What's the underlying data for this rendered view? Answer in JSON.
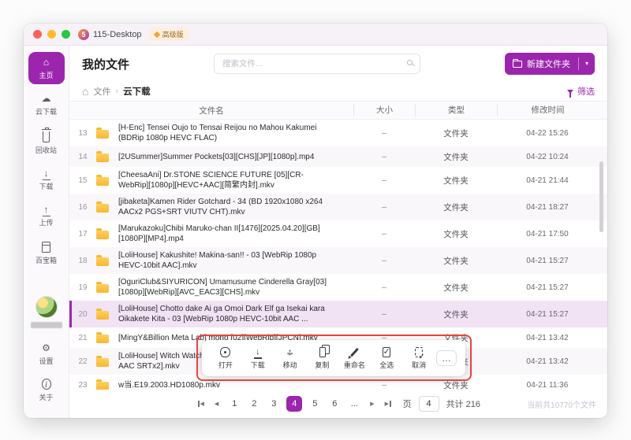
{
  "colors": {
    "accent": "#9b26ad",
    "accent_light": "#f1e2f4",
    "annotation": "#e8433f",
    "folder": "#f7b733",
    "stripe": "#faf7fb"
  },
  "window": {
    "logo_text": "5",
    "title": "115-Desktop",
    "badge": "高级版"
  },
  "sidebar": {
    "items": [
      {
        "label": "主页",
        "icon": "home",
        "active": true
      },
      {
        "label": "云下载",
        "icon": "cloud-download"
      },
      {
        "label": "回收站",
        "icon": "trash"
      },
      {
        "label": "下载",
        "icon": "download"
      },
      {
        "label": "上传",
        "icon": "upload"
      },
      {
        "label": "百宝箱",
        "icon": "box"
      }
    ],
    "bottom_items": [
      {
        "label": "设置",
        "icon": "gear"
      },
      {
        "label": "关于",
        "icon": "info"
      }
    ]
  },
  "header": {
    "page_title": "我的文件",
    "search_placeholder": "搜索文件...",
    "new_folder_label": "新建文件夹"
  },
  "breadcrumb": {
    "root": "文件",
    "current": "云下载",
    "filter_label": "筛选"
  },
  "table": {
    "columns": [
      "文件名",
      "大小",
      "类型",
      "修改时间"
    ],
    "rows": [
      {
        "index": 13,
        "name": "[H-Enc] Tensei Oujo to Tensai Reijou no Mahou Kakumei (BDRip 1080p HEVC FLAC)",
        "size": "–",
        "type": "文件夹",
        "modified": "04-22 15:26"
      },
      {
        "index": 14,
        "name": "[2USummer]Summer Pockets[03][CHS][JP][1080p].mp4",
        "size": "–",
        "type": "文件夹",
        "modified": "04-22 10:24"
      },
      {
        "index": 15,
        "name": "[CheesaAni] Dr.STONE SCIENCE FUTURE [05][CR-WebRip][1080p][HEVC+AAC][简繁内封].mkv",
        "size": "–",
        "type": "文件夹",
        "modified": "04-21 21:44"
      },
      {
        "index": 16,
        "name": "[jibaketa]Kamen Rider Gotchard - 34 (BD 1920x1080 x264 AACx2 PGS+SRT VIUTV CHT).mkv",
        "size": "–",
        "type": "文件夹",
        "modified": "04-21 18:27"
      },
      {
        "index": 17,
        "name": "[Marukazoku]Chibi Maruko-chan II[1476][2025.04.20][GB][1080P][MP4].mp4",
        "size": "–",
        "type": "文件夹",
        "modified": "04-21 17:50"
      },
      {
        "index": 18,
        "name": "[LoliHouse] Kakushite! Makina-san!! - 03 [WebRip 1080p HEVC-10bit AAC].mkv",
        "size": "–",
        "type": "文件夹",
        "modified": "04-21 15:27"
      },
      {
        "index": 19,
        "name": "[OguriClub&SIYURICON] Umamusume Cinderella Gray[03][1080p][WebRip][AVC_EAC3][CHS].mkv",
        "size": "–",
        "type": "文件夹",
        "modified": "04-21 15:27"
      },
      {
        "index": 20,
        "name": "[LoliHouse] Chotto dake Ai ga Omoi Dark Elf ga Isekai kara Oikakete Kita - 03 [WebRip 1080p HEVC-10bit AAC ...",
        "size": "–",
        "type": "文件夹",
        "modified": "04-21 15:27",
        "selected": true
      },
      {
        "index": 21,
        "name": "[MingY&Billion Meta Lab] mono [02][WebRip][JPCN].mkv",
        "size": "–",
        "type": "文件夹",
        "modified": "04-21 13:42"
      },
      {
        "index": 22,
        "name": "[LoliHouse] Witch Watch - 03 [WebRip 1080p HEVC-10bit AAC SRTx2].mkv",
        "size": "–",
        "type": "文件夹",
        "modified": "04-21 13:42"
      },
      {
        "index": 23,
        "name": "w当.E19.2003.HD1080p.mkv",
        "size": "–",
        "type": "文件夹",
        "modified": "04-21 11:36"
      }
    ]
  },
  "toolbar": {
    "actions": [
      {
        "label": "打开",
        "icon": "eye"
      },
      {
        "label": "下载",
        "icon": "download"
      },
      {
        "label": "移动",
        "icon": "move"
      },
      {
        "label": "复制",
        "icon": "copy"
      },
      {
        "label": "重命名",
        "icon": "rename"
      },
      {
        "label": "全选",
        "icon": "select-all"
      },
      {
        "label": "取消",
        "icon": "cancel"
      }
    ],
    "more_label": "…"
  },
  "pagination": {
    "pages": [
      {
        "label": "1"
      },
      {
        "label": "2"
      },
      {
        "label": "3"
      },
      {
        "label": "4",
        "current": true
      },
      {
        "label": "5"
      },
      {
        "label": "6"
      },
      {
        "label": "..."
      }
    ],
    "page_label": "页",
    "page_input": "4",
    "total_label": "共计 216",
    "files_count": "当前共10770个文件"
  }
}
